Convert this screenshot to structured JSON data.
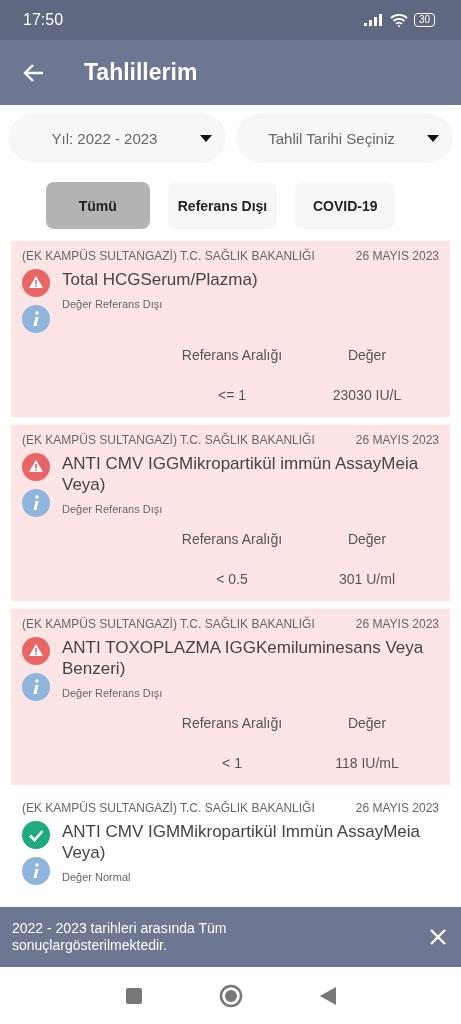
{
  "status_bar": {
    "time": "17:50",
    "battery": "30"
  },
  "app_bar": {
    "title": "Tahlillerim"
  },
  "filters": [
    {
      "value": "Yıl: 2022 - 2023"
    },
    {
      "value": "Tahlil Tarihi Seçiniz"
    }
  ],
  "chips": [
    {
      "label": "Tümü",
      "selected": true
    },
    {
      "label": "Referans Dışı",
      "selected": false
    },
    {
      "label": "COVID-19",
      "selected": false
    }
  ],
  "results": [
    {
      "kind": "alert",
      "institution": "(EK KAMPÜS SULTANGAZİ) T.C. SAĞLIK BAKANLIĞI",
      "date": "26 MAYIS 2023",
      "test": "Total HCGSerum/Plazma)",
      "status": "Değer Referans Dışı",
      "range_label": "Referans Aralığı",
      "value_label": "Değer",
      "range": "<= 1",
      "value": "23030 IU/L"
    },
    {
      "kind": "alert",
      "institution": "(EK KAMPÜS SULTANGAZİ) T.C. SAĞLIK BAKANLIĞI",
      "date": "26 MAYIS 2023",
      "test": "ANTI CMV IGGMikropartikül immün AssayMeia Veya)",
      "status": "Değer Referans Dışı",
      "range_label": "Referans Aralığı",
      "value_label": "Değer",
      "range": "< 0.5",
      "value": "301 U/ml"
    },
    {
      "kind": "alert",
      "institution": "(EK KAMPÜS SULTANGAZİ) T.C. SAĞLIK BAKANLIĞI",
      "date": "26 MAYIS 2023",
      "test": "ANTI TOXOPLAZMA IGGKemiluminesans Veya Benzeri)",
      "status": "Değer Referans Dışı",
      "range_label": "Referans Aralığı",
      "value_label": "Değer",
      "range": "< 1",
      "value": "118 IU/mL"
    },
    {
      "kind": "normal",
      "institution": "(EK KAMPÜS SULTANGAZİ) T.C. SAĞLIK BAKANLIĞI",
      "date": "26 MAYIS 2023",
      "test": "ANTI CMV IGMMikropartikül Immün AssayMeia Veya)",
      "status": "Değer Normal"
    }
  ],
  "snackbar": {
    "message": "2022 - 2023 tarihleri arasında Tüm sonuçlargösterilmektedir."
  }
}
